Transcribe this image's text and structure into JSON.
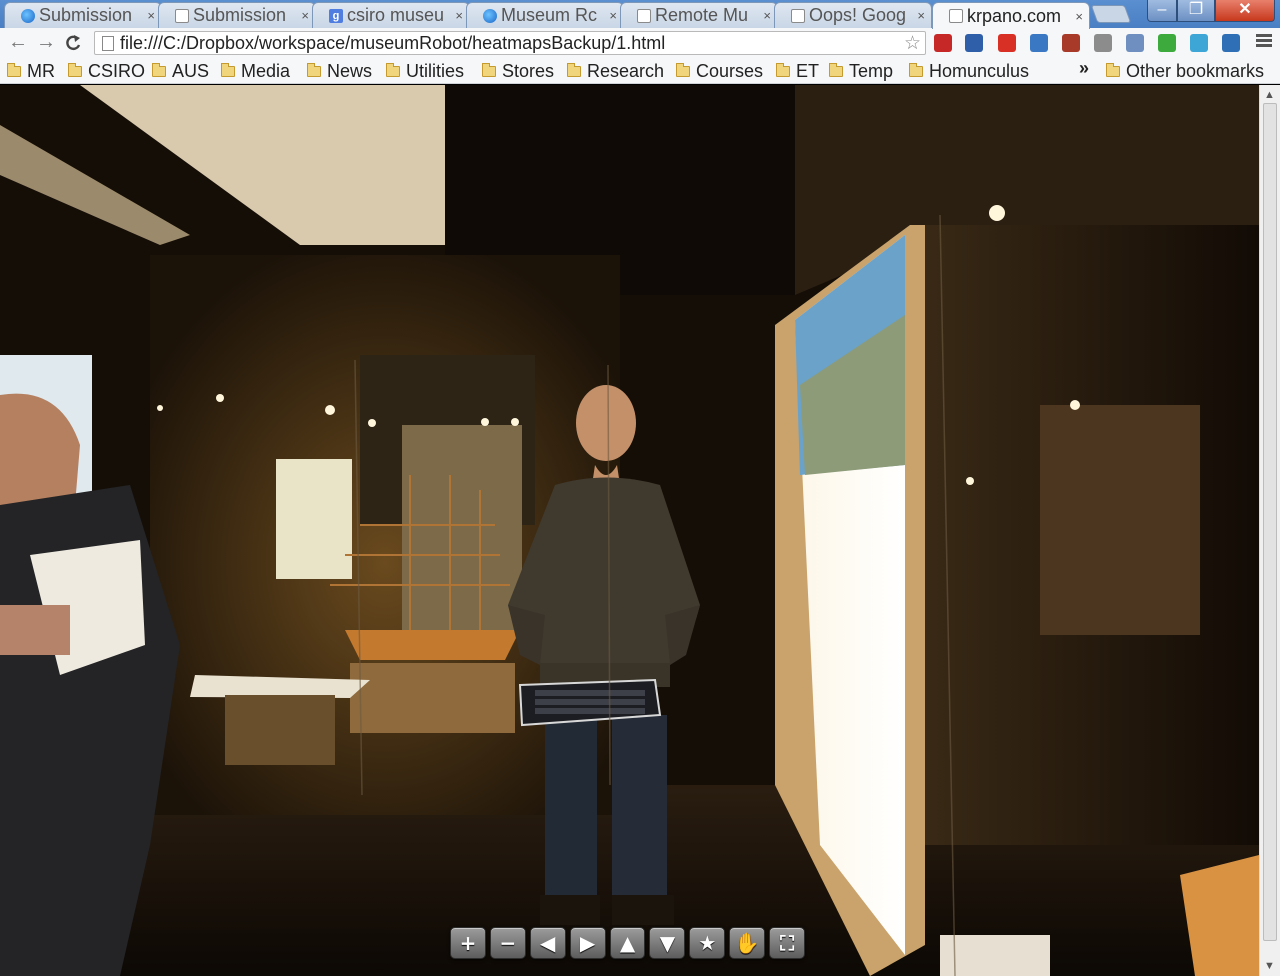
{
  "tabs": [
    {
      "title": "Submission",
      "icon": "ie-icon"
    },
    {
      "title": "Submission",
      "icon": "page-icon"
    },
    {
      "title": "csiro museu",
      "icon": "google-icon"
    },
    {
      "title": "Museum Rc",
      "icon": "ie-icon"
    },
    {
      "title": "Remote Mu",
      "icon": "page-icon"
    },
    {
      "title": "Oops! Goog",
      "icon": "page-icon"
    },
    {
      "title": "krpano.com",
      "icon": "page-icon",
      "active": true
    }
  ],
  "tab_close_glyph": "×",
  "window": {
    "minimize": "–",
    "maximize": "❐",
    "close": "✕"
  },
  "toolbar": {
    "back": "←",
    "forward": "→",
    "reload": "C",
    "url": "file:///C:/Dropbox/workspace/museumRobot/heatmapsBackup/1.html",
    "star": "☆",
    "extension_colors": [
      "#c62828",
      "#2f5fa8",
      "#d93025",
      "#3b78c4",
      "#a83a2a",
      "#8c8c8c",
      "#6e8fbf",
      "#3caa3c",
      "#3da6d6",
      "#2f6fb5"
    ]
  },
  "bookmarks": {
    "items": [
      "MR",
      "CSIRO",
      "AUS",
      "Media",
      "News",
      "Utilities",
      "Stores",
      "Research",
      "Courses",
      "ET",
      "Temp",
      "Homunculus"
    ],
    "more": "»",
    "other": "Other bookmarks"
  },
  "krpano_controls": [
    {
      "name": "zoom-in",
      "glyph": "+"
    },
    {
      "name": "zoom-out",
      "glyph": "−"
    },
    {
      "name": "pan-left",
      "glyph": "◀"
    },
    {
      "name": "pan-right",
      "glyph": "▶"
    },
    {
      "name": "pan-up",
      "glyph": "▲"
    },
    {
      "name": "pan-down",
      "glyph": "▼"
    },
    {
      "name": "hotspot-star",
      "glyph": "★"
    },
    {
      "name": "hand-drag",
      "glyph": "✋"
    },
    {
      "name": "fullscreen",
      "glyph": "⛶"
    }
  ],
  "scrollbar": {
    "up": "▲",
    "down": "▼"
  }
}
